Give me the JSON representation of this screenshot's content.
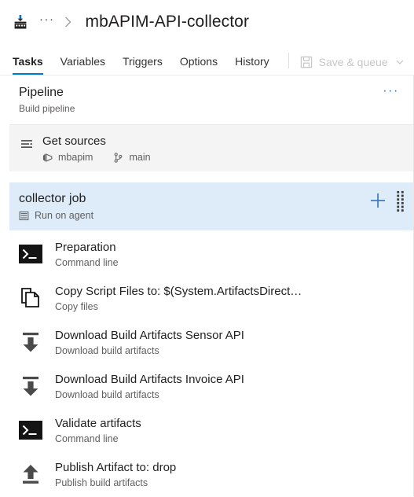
{
  "breadcrumb": {
    "icon": "build-pipeline-icon",
    "ellipsis": "···",
    "separator_icon": "chevron-right-icon",
    "title": "mbAPIM-API-collector"
  },
  "tabs": [
    {
      "label": "Tasks",
      "active": true
    },
    {
      "label": "Variables",
      "active": false
    },
    {
      "label": "Triggers",
      "active": false
    },
    {
      "label": "Options",
      "active": false
    },
    {
      "label": "History",
      "active": false
    }
  ],
  "toolbar": {
    "save_queue_label": "Save & queue",
    "save_icon": "save-floppy-icon",
    "chevron_icon": "chevron-down-icon",
    "disabled": true
  },
  "pipeline": {
    "title": "Pipeline",
    "subtitle": "Build pipeline",
    "overflow": "···"
  },
  "get_sources": {
    "icon": "get-sources-icon",
    "title": "Get sources",
    "repo_icon": "azure-repos-icon",
    "repo": "mbapim",
    "branch_icon": "branch-icon",
    "branch": "main"
  },
  "job": {
    "title": "collector job",
    "agent_icon": "agent-server-icon",
    "agent_label": "Run on agent",
    "add_icon": "plus-icon",
    "drag_icon": "drag-handle-icon",
    "selected": true
  },
  "tasks": [
    {
      "title": "Preparation",
      "subtitle": "Command line",
      "icon": "command-line-icon"
    },
    {
      "title": "Copy Script Files to: $(System.ArtifactsDirect…",
      "subtitle": "Copy files",
      "icon": "copy-files-icon"
    },
    {
      "title": "Download Build Artifacts Sensor API",
      "subtitle": "Download build artifacts",
      "icon": "download-artifacts-icon"
    },
    {
      "title": "Download Build Artifacts Invoice API",
      "subtitle": "Download build artifacts",
      "icon": "download-artifacts-icon"
    },
    {
      "title": "Validate artifacts",
      "subtitle": "Command line",
      "icon": "command-line-icon"
    },
    {
      "title": "Publish Artifact to: drop",
      "subtitle": "Publish build artifacts",
      "icon": "publish-artifacts-icon"
    }
  ],
  "colors": {
    "accent": "#0078d4",
    "selected_row": "#deecf9",
    "sources_row": "#f4f4f4",
    "text_primary": "#201f1e",
    "text_secondary": "#605e5c",
    "disabled": "#c8c6c4"
  }
}
